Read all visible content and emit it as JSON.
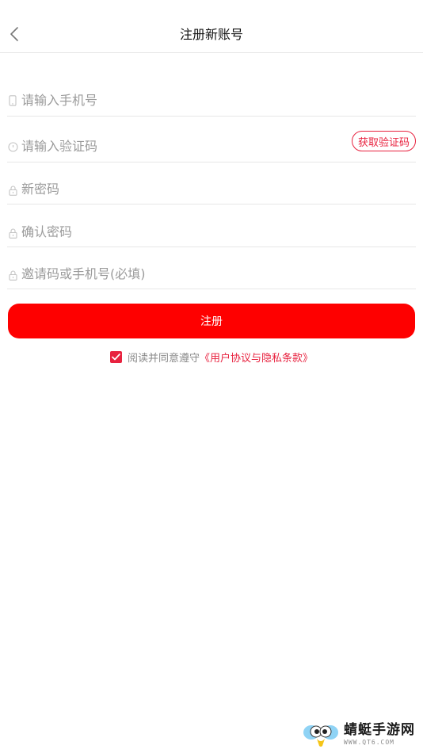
{
  "header": {
    "title": "注册新账号",
    "back_icon": "chevron-left-icon"
  },
  "form": {
    "phone": {
      "placeholder": "请输入手机号",
      "value": "",
      "icon": "phone-icon"
    },
    "code": {
      "placeholder": "请输入验证码",
      "value": "",
      "icon": "shield-icon",
      "get_code_label": "获取验证码"
    },
    "password": {
      "placeholder": "新密码",
      "value": "",
      "icon": "lock-icon"
    },
    "confirm_password": {
      "placeholder": "确认密码",
      "value": "",
      "icon": "lock-icon"
    },
    "invite": {
      "placeholder": "邀请码或手机号(必填)",
      "value": "",
      "icon": "lock-icon"
    }
  },
  "register_button": {
    "label": "注册"
  },
  "agreement": {
    "checked": true,
    "text": "阅读并同意遵守",
    "link": "《用户协议与隐私条款》"
  },
  "watermark": {
    "title": "蜻蜓手游网",
    "subtitle": "WWW.QT6.COM"
  },
  "colors": {
    "accent": "#e8223f",
    "button": "#fe0000",
    "placeholder": "#9b9b9b",
    "divider": "#e7e7e7"
  }
}
